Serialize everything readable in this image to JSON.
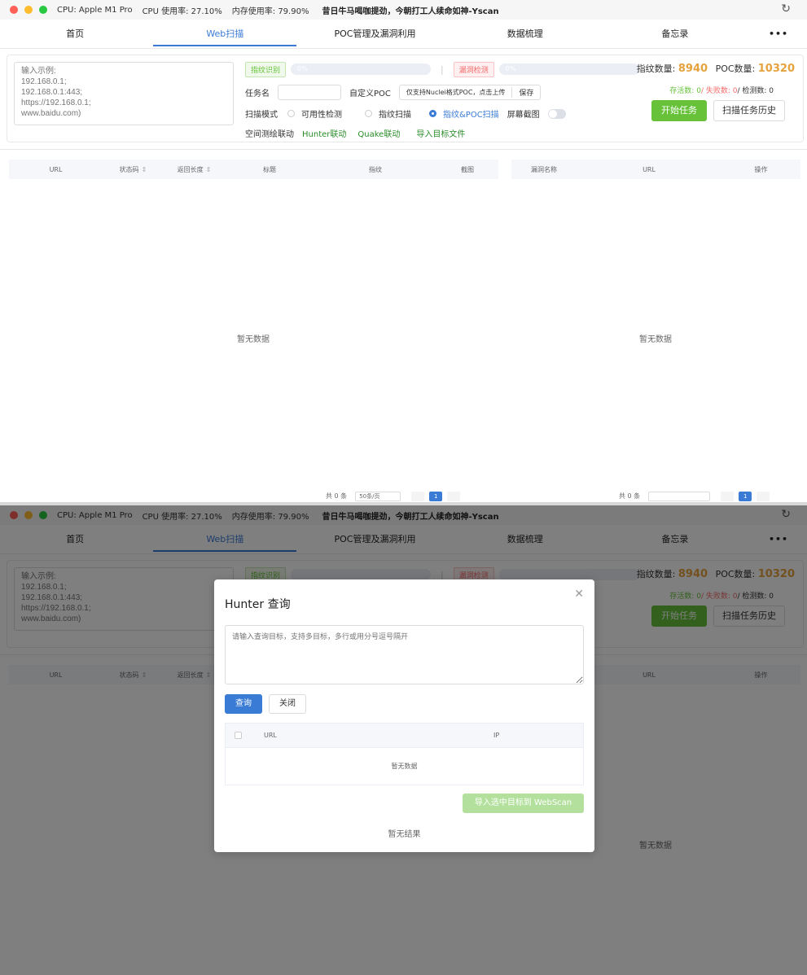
{
  "titlebar": {
    "cpu_model": "CPU: Apple M1 Pro",
    "cpu_usage": "CPU 使用率: 27.10%",
    "mem_usage": "内存使用率: 79.90%",
    "motto": "昔日牛马喝咖提劲，今朝打工人续命如神-Yscan",
    "refresh_icon": "refresh-icon"
  },
  "tabs": [
    {
      "label": "首页"
    },
    {
      "label": "Web扫描",
      "active": true
    },
    {
      "label": "POC管理及漏洞利用"
    },
    {
      "label": "数据梳理"
    },
    {
      "label": "备忘录"
    },
    {
      "label": "•••"
    }
  ],
  "panel": {
    "target_placeholder": "输入示例:\n192.168.0.1;\n192.168.0.1:443;\nhttps://192.168.0.1;\nwww.baidu.com)",
    "fingerprint_tag": "指纹识别",
    "fingerprint_progress": "0%",
    "vuln_tag": "漏洞检测",
    "vuln_progress": "0%",
    "separator": "|",
    "task_name_label": "任务名",
    "custom_poc_label": "自定义POC",
    "poc_upload_hint": "仅支持Nuclei格式POC，点击上传",
    "save_label": "保存",
    "scan_mode_label": "扫描模式",
    "modes": [
      {
        "label": "可用性检测",
        "checked": false
      },
      {
        "label": "指纹扫描",
        "checked": false
      },
      {
        "label": "指纹&POC扫描",
        "checked": true
      }
    ],
    "screenshot_label": "屏幕截图",
    "screenshot_enabled": false,
    "mapping_label": "空间测绘联动",
    "hunter_link": "Hunter联动",
    "quake_link": "Quake联动",
    "import_link": "导入目标文件",
    "fingerprint_count_label": "指纹数量: ",
    "fingerprint_count": "8940",
    "poc_count_label": "POC数量: ",
    "poc_count": "10320",
    "alive_label": "存活数: ",
    "alive_count": "0",
    "fail_label": "/ 失败数: ",
    "fail_count": "0",
    "checked_label": "/ 检测数: ",
    "checked_count": "0",
    "start_button": "开始任务",
    "history_button": "扫描任务历史",
    "colors": {
      "accent": "#3a7bd5",
      "success": "#67c23a",
      "danger": "#f56c6c",
      "warning": "#e6a23c"
    }
  },
  "left_table": {
    "columns": [
      "URL",
      "状态码",
      "返回长度",
      "标题",
      "指纹",
      "截图"
    ],
    "empty_text": "暂无数据",
    "pager_total": "共 0 条",
    "page_size": "50条/页",
    "current_page": "1"
  },
  "right_table": {
    "columns": [
      "漏洞名称",
      "URL",
      "操作"
    ],
    "empty_text": "暂无数据",
    "pager_total": "共 0 条",
    "current_page": "1"
  },
  "dialog": {
    "title": "Hunter 查询",
    "close_icon": "close-icon",
    "query_placeholder": "请输入查询目标，支持多目标，多行或用分号逗号隔开",
    "query_button": "查询",
    "close_button": "关闭",
    "columns": [
      "URL",
      "IP"
    ],
    "empty_text": "暂无数据",
    "import_button": "导入选中目标到 WebScan",
    "no_result": "暂无结果"
  }
}
